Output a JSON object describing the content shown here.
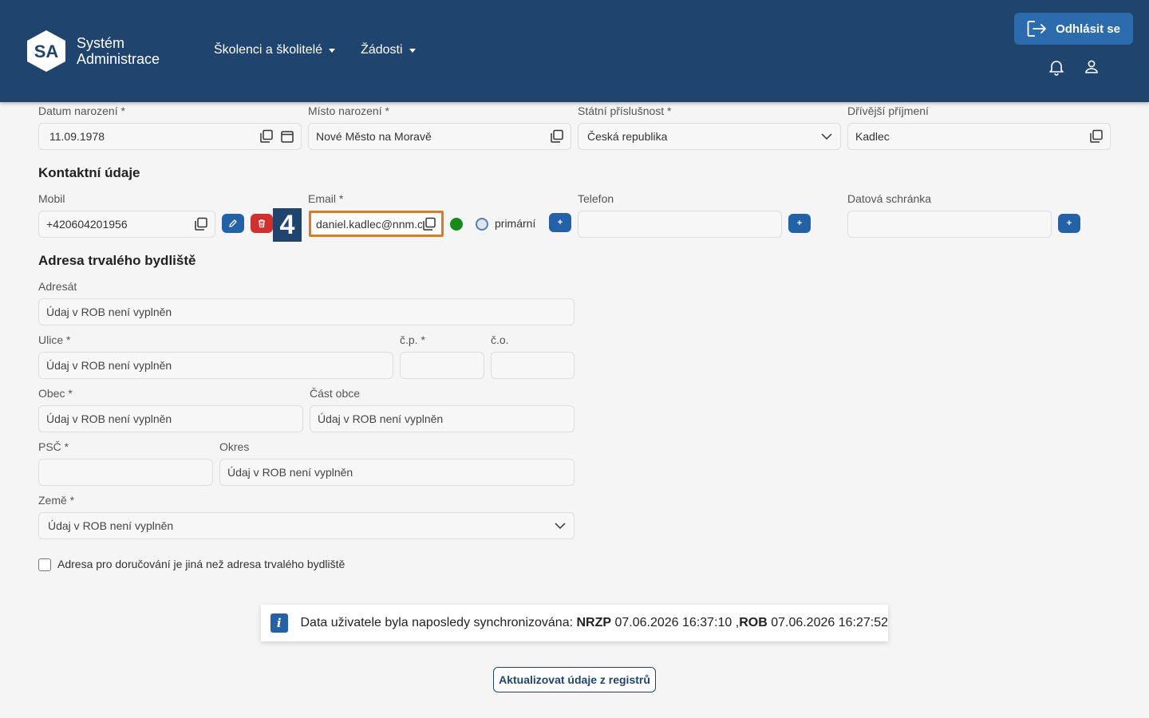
{
  "header": {
    "logo_badge": "SA",
    "logo_line1": "Systém",
    "logo_line2": "Administrace",
    "nav": [
      "Školenci a školitelé",
      "Žádosti"
    ],
    "logout_label": "Odhlásit se"
  },
  "personal": {
    "birth_date_label": "Datum narození *",
    "birth_date": "11.09.1978",
    "birth_place_label": "Místo narození *",
    "birth_place": "Nové Město na Moravě",
    "citizenship_label": "Státní příslušnost *",
    "citizenship": "Česká republika",
    "previous_surname_label": "Dřívější příjmení",
    "previous_surname": "Kadlec"
  },
  "contact": {
    "title": "Kontaktní údaje",
    "mobile_label": "Mobil",
    "mobile": "+420604201956",
    "email_label": "Email *",
    "email": "daniel.kadlec@nnm.c",
    "primary_label": "primární",
    "step_badge": "4",
    "phone_label": "Telefon",
    "phone": "",
    "databox_label": "Datová schránka",
    "databox": "",
    "plus": "+"
  },
  "address": {
    "title": "Adresa trvalého bydliště",
    "placeholder": "Údaj v ROB není vyplněn",
    "recipient_label": "Adresát",
    "street_label": "Ulice *",
    "cp_label": "č.p. *",
    "co_label": "č.o.",
    "city_label": "Obec *",
    "city_part_label": "Část obce",
    "psc_label": "PSČ *",
    "district_label": "Okres",
    "country_label": "Země *",
    "delivery_checkbox_label": "Adresa pro doručování je jiná než adresa trvalého bydliště"
  },
  "sync": {
    "prefix": "Data uživatele byla naposledy synchronizována: ",
    "nrzp_label": "NRZP",
    "nrzp_time": " 07.06.2026 16:37:10 ,",
    "rob_label": "ROB",
    "rob_time": " 07.06.2026 16:27:52"
  },
  "update_button": "Aktualizovat údaje z registrů",
  "colors": {
    "header": "#1f446e",
    "accent": "#2462a8",
    "danger": "#d32f2f",
    "highlight": "#e07b1a",
    "status_green": "#178a17"
  }
}
